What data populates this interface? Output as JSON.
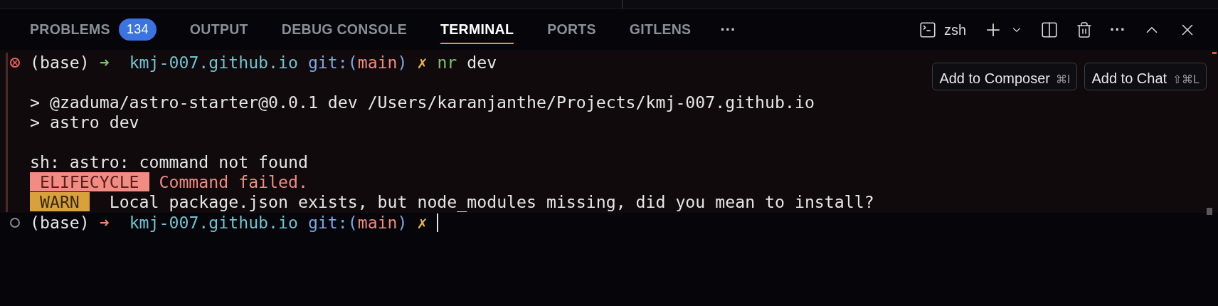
{
  "panel": {
    "tabs": [
      {
        "label": "PROBLEMS",
        "selected": false,
        "badge": "134"
      },
      {
        "label": "OUTPUT",
        "selected": false
      },
      {
        "label": "DEBUG CONSOLE",
        "selected": false
      },
      {
        "label": "TERMINAL",
        "selected": true
      },
      {
        "label": "PORTS",
        "selected": false
      },
      {
        "label": "GITLENS",
        "selected": false
      }
    ],
    "more": "···",
    "shell": "zsh",
    "actions_more": "···"
  },
  "terminal": {
    "blocks": [
      {
        "failed": true,
        "lines": [
          {
            "segments": [
              {
                "text": "(base) ",
                "kind": "plain"
              },
              {
                "text": "➜  ",
                "kind": "arrow-ok"
              },
              {
                "text": "kmj-007.github.io ",
                "kind": "dir"
              },
              {
                "text": "git:(",
                "kind": "git"
              },
              {
                "text": "main",
                "kind": "branch"
              },
              {
                "text": ") ",
                "kind": "git"
              },
              {
                "text": "✗ ",
                "kind": "dirty"
              },
              {
                "text": "nr ",
                "kind": "cmd"
              },
              {
                "text": "dev",
                "kind": "plain"
              }
            ]
          },
          {
            "kind": "blank"
          },
          {
            "segments": [
              {
                "text": "> @zaduma/astro-starter@0.0.1 dev /Users/karanjanthe/Projects/kmj-007.github.io",
                "kind": "plain"
              }
            ]
          },
          {
            "segments": [
              {
                "text": "> astro dev",
                "kind": "plain"
              }
            ]
          },
          {
            "kind": "blank"
          },
          {
            "segments": [
              {
                "text": "sh: astro: command not found",
                "kind": "plain"
              }
            ]
          },
          {
            "segments": [
              {
                "text": " ELIFECYCLE ",
                "kind": "badge-error"
              },
              {
                "text": " Command failed.",
                "kind": "error"
              }
            ]
          },
          {
            "segments": [
              {
                "text": " WARN ",
                "kind": "badge-warn"
              },
              {
                "text": "  Local package.json exists, but node_modules missing, did you mean to install?",
                "kind": "plain"
              }
            ]
          }
        ]
      },
      {
        "failed": false,
        "cursor": true,
        "lines": [
          {
            "segments": [
              {
                "text": "(base) ",
                "kind": "plain"
              },
              {
                "text": "➜  ",
                "kind": "arrow-err"
              },
              {
                "text": "kmj-007.github.io ",
                "kind": "dir"
              },
              {
                "text": "git:(",
                "kind": "git"
              },
              {
                "text": "main",
                "kind": "branch"
              },
              {
                "text": ") ",
                "kind": "git"
              },
              {
                "text": "✗ ",
                "kind": "dirty"
              }
            ]
          }
        ]
      }
    ]
  },
  "overlay_buttons": [
    {
      "label": "Add to Composer",
      "shortcut": "⌘I"
    },
    {
      "label": "Add to Chat",
      "shortcut": "⇧⌘L"
    }
  ]
}
